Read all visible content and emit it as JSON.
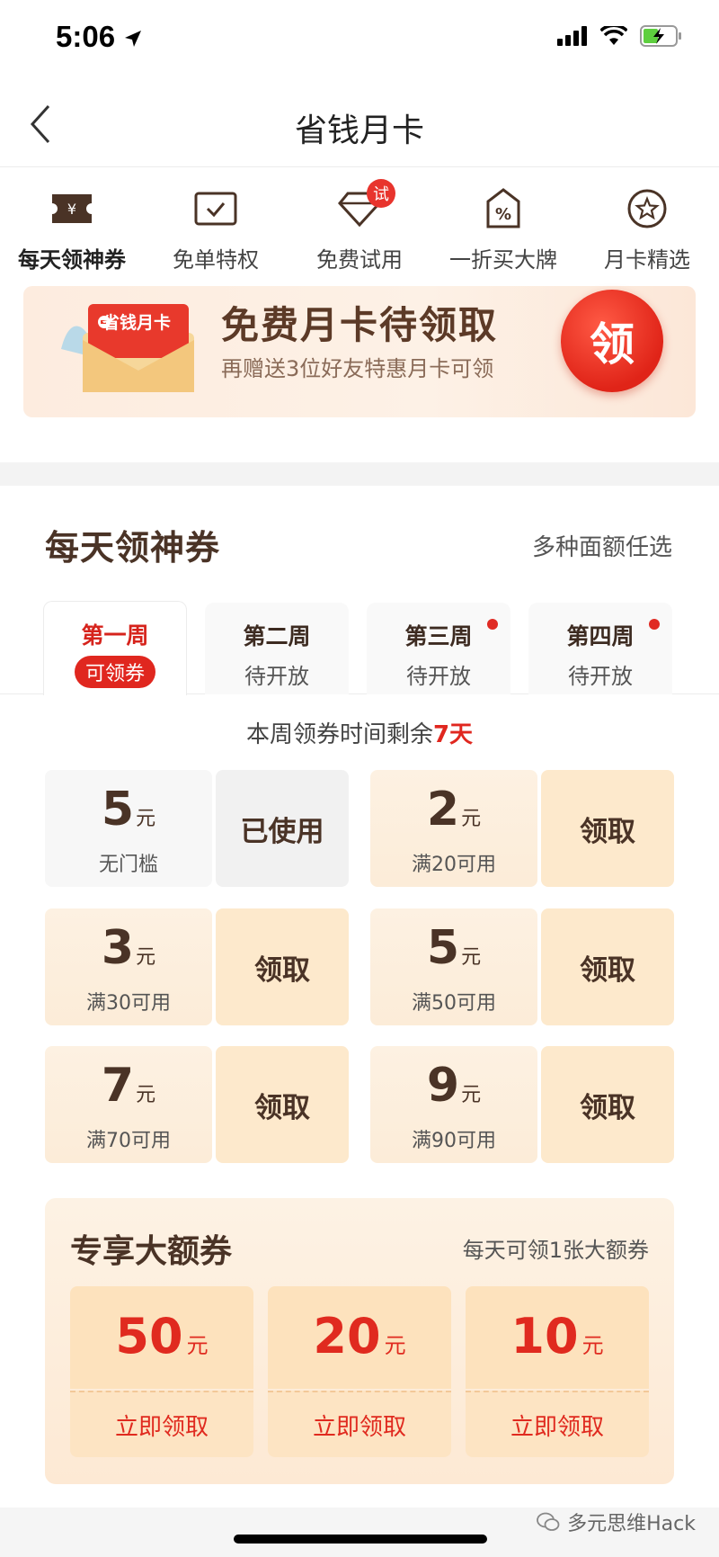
{
  "status": {
    "time": "5:06"
  },
  "nav": {
    "title": "省钱月卡"
  },
  "icons": [
    {
      "label": "每天领神券",
      "icon": "ticket-icon"
    },
    {
      "label": "免单特权",
      "icon": "check-card-icon"
    },
    {
      "label": "免费试用",
      "icon": "diamond-icon",
      "badge": "试"
    },
    {
      "label": "一折买大牌",
      "icon": "discount-tag-icon"
    },
    {
      "label": "月卡精选",
      "icon": "star-circle-icon"
    }
  ],
  "banner": {
    "envelope_text": "省钱月卡",
    "title": "免费月卡待领取",
    "subtitle": "再赠送3位好友特惠月卡可领",
    "button": "领"
  },
  "section": {
    "title": "每天领神券",
    "more": "多种面额任选"
  },
  "tabs": [
    {
      "title": "第一周",
      "status": "可领券"
    },
    {
      "title": "第二周",
      "status": "待开放"
    },
    {
      "title": "第三周",
      "status": "待开放"
    },
    {
      "title": "第四周",
      "status": "待开放"
    }
  ],
  "remain": {
    "prefix": "本周领券时间剩余",
    "days": "7天"
  },
  "coupons": [
    {
      "amount": "5",
      "unit": "元",
      "condition": "无门槛",
      "action": "已使用"
    },
    {
      "amount": "2",
      "unit": "元",
      "condition": "满20可用",
      "action": "领取"
    },
    {
      "amount": "3",
      "unit": "元",
      "condition": "满30可用",
      "action": "领取"
    },
    {
      "amount": "5",
      "unit": "元",
      "condition": "满50可用",
      "action": "领取"
    },
    {
      "amount": "7",
      "unit": "元",
      "condition": "满70可用",
      "action": "领取"
    },
    {
      "amount": "9",
      "unit": "元",
      "condition": "满90可用",
      "action": "领取"
    }
  ],
  "big": {
    "title": "专享大额券",
    "subtitle": "每天可领1张大额券",
    "cards": [
      {
        "value": "50",
        "unit": "元",
        "action": "立即领取"
      },
      {
        "value": "20",
        "unit": "元",
        "action": "立即领取"
      },
      {
        "value": "10",
        "unit": "元",
        "action": "立即领取"
      }
    ]
  },
  "watermark": "多元思维Hack",
  "colors": {
    "accent_red": "#e0271f",
    "text_brown": "#4a3326",
    "coupon_bg": "#fde9cc"
  }
}
